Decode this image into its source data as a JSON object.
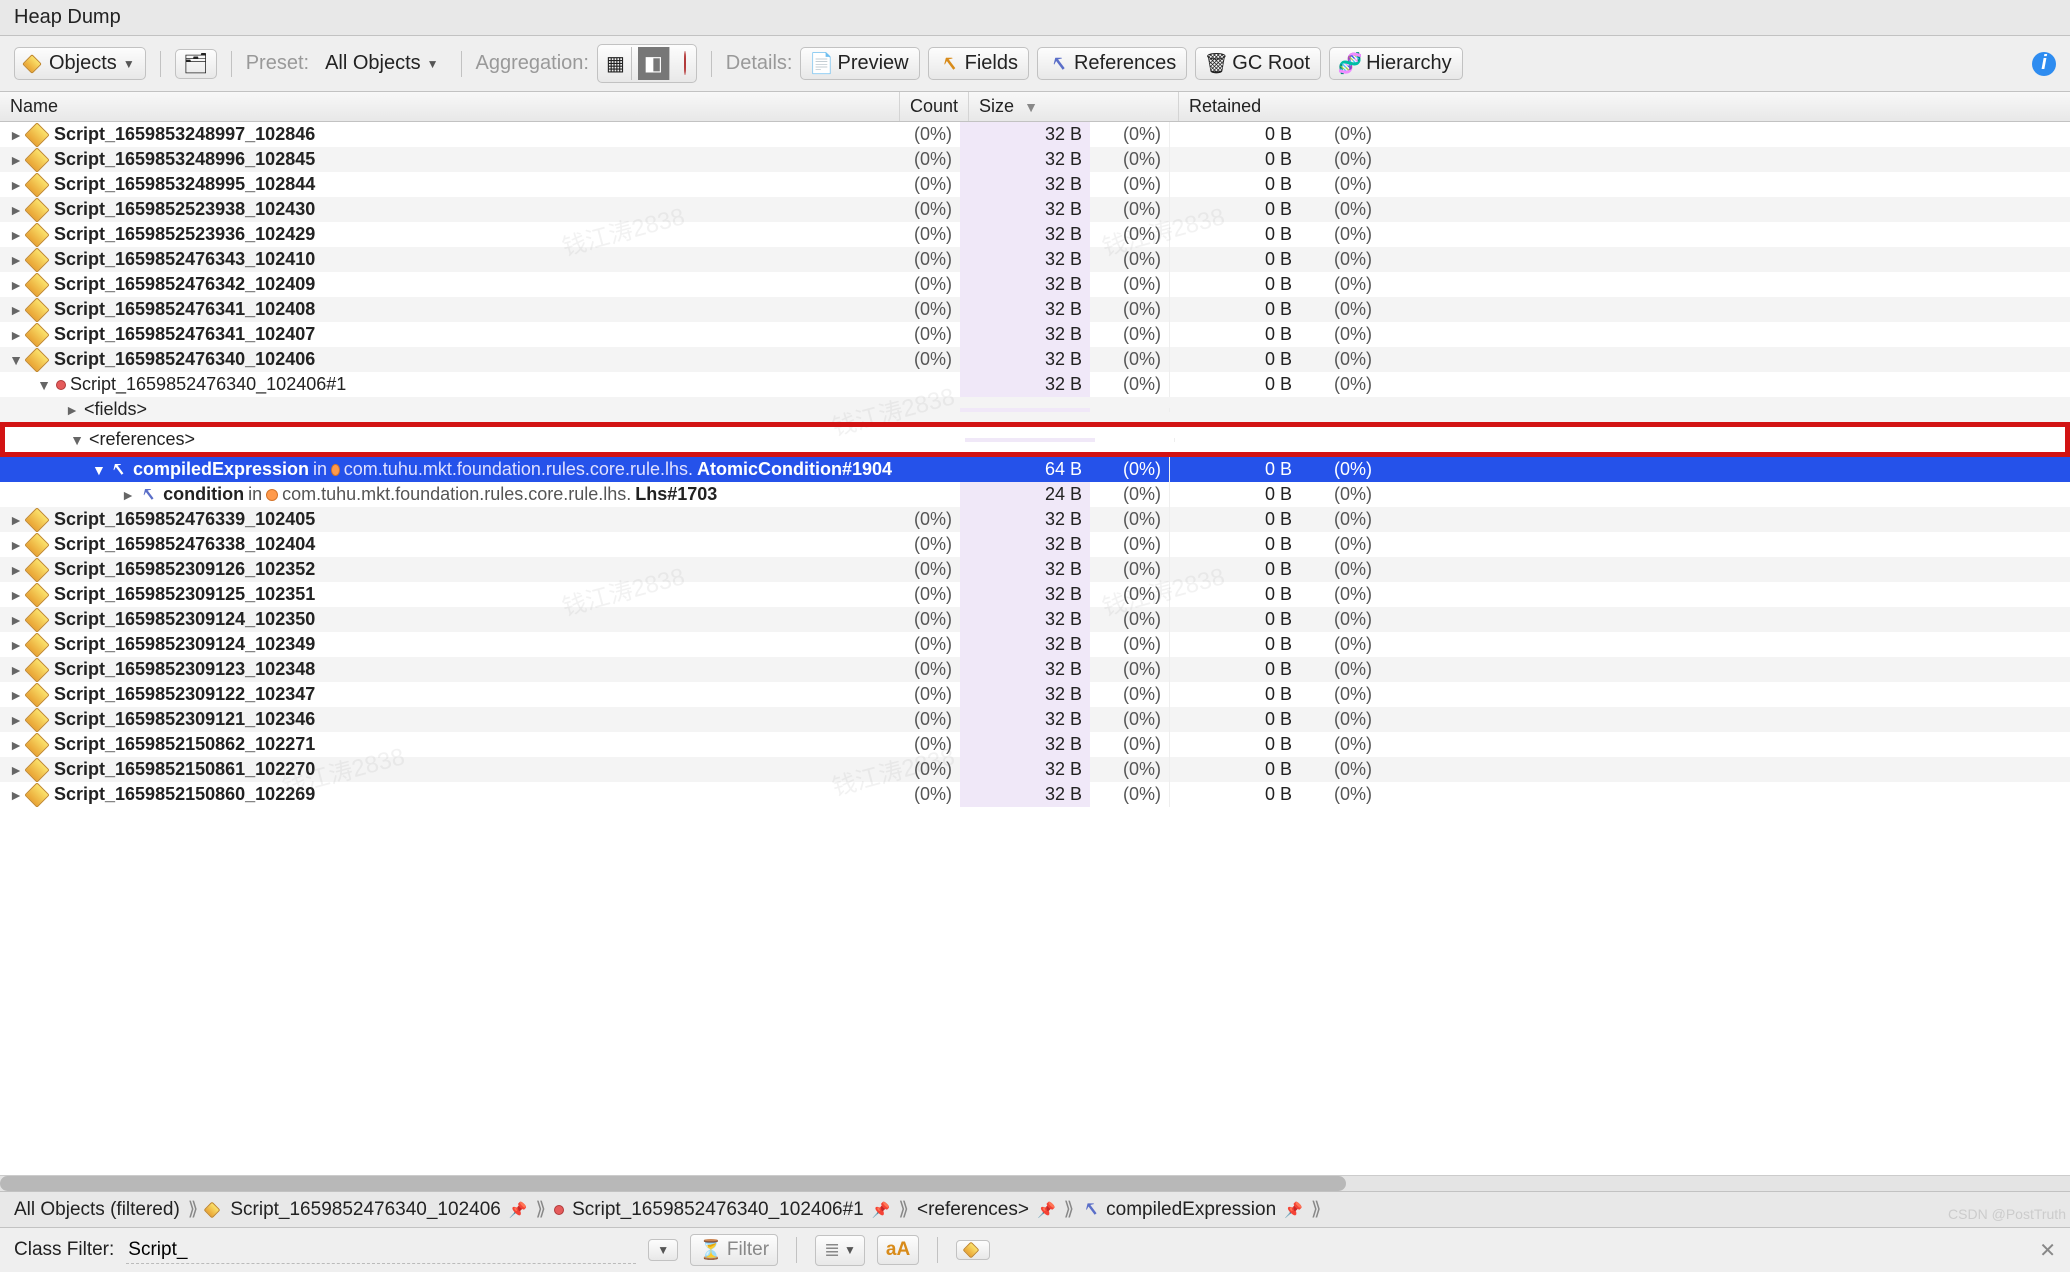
{
  "window_title": "Heap Dump",
  "toolbar": {
    "objects_btn": "Objects",
    "preset_label": "Preset:",
    "preset_value": "All Objects",
    "aggregation_label": "Aggregation:",
    "details_label": "Details:",
    "preview_btn": "Preview",
    "fields_btn": "Fields",
    "references_btn": "References",
    "gcroot_btn": "GC Root",
    "hierarchy_btn": "Hierarchy"
  },
  "columns": {
    "c0": "Name",
    "c1": "Count",
    "c2": "Size",
    "c3": "Retained"
  },
  "rows": [
    {
      "indent": 0,
      "exp": "►",
      "icon": "class",
      "name": "Script_1659853248997_102846",
      "bold": true,
      "count": "(0%)",
      "size": "32 B",
      "sizePct": "(0%)",
      "ret": "0 B",
      "retPct": "(0%)",
      "alt": false
    },
    {
      "indent": 0,
      "exp": "►",
      "icon": "class",
      "name": "Script_1659853248996_102845",
      "bold": true,
      "count": "(0%)",
      "size": "32 B",
      "sizePct": "(0%)",
      "ret": "0 B",
      "retPct": "(0%)",
      "alt": true
    },
    {
      "indent": 0,
      "exp": "►",
      "icon": "class",
      "name": "Script_1659853248995_102844",
      "bold": true,
      "count": "(0%)",
      "size": "32 B",
      "sizePct": "(0%)",
      "ret": "0 B",
      "retPct": "(0%)",
      "alt": false
    },
    {
      "indent": 0,
      "exp": "►",
      "icon": "class",
      "name": "Script_1659852523938_102430",
      "bold": true,
      "count": "(0%)",
      "size": "32 B",
      "sizePct": "(0%)",
      "ret": "0 B",
      "retPct": "(0%)",
      "alt": true
    },
    {
      "indent": 0,
      "exp": "►",
      "icon": "class",
      "name": "Script_1659852523936_102429",
      "bold": true,
      "count": "(0%)",
      "size": "32 B",
      "sizePct": "(0%)",
      "ret": "0 B",
      "retPct": "(0%)",
      "alt": false
    },
    {
      "indent": 0,
      "exp": "►",
      "icon": "class",
      "name": "Script_1659852476343_102410",
      "bold": true,
      "count": "(0%)",
      "size": "32 B",
      "sizePct": "(0%)",
      "ret": "0 B",
      "retPct": "(0%)",
      "alt": true
    },
    {
      "indent": 0,
      "exp": "►",
      "icon": "class",
      "name": "Script_1659852476342_102409",
      "bold": true,
      "count": "(0%)",
      "size": "32 B",
      "sizePct": "(0%)",
      "ret": "0 B",
      "retPct": "(0%)",
      "alt": false
    },
    {
      "indent": 0,
      "exp": "►",
      "icon": "class",
      "name": "Script_1659852476341_102408",
      "bold": true,
      "count": "(0%)",
      "size": "32 B",
      "sizePct": "(0%)",
      "ret": "0 B",
      "retPct": "(0%)",
      "alt": true
    },
    {
      "indent": 0,
      "exp": "►",
      "icon": "class",
      "name": "Script_1659852476341_102407",
      "bold": true,
      "count": "(0%)",
      "size": "32 B",
      "sizePct": "(0%)",
      "ret": "0 B",
      "retPct": "(0%)",
      "alt": false
    },
    {
      "indent": 0,
      "exp": "▼",
      "icon": "class",
      "name": "Script_1659852476340_102406",
      "bold": true,
      "count": "(0%)",
      "size": "32 B",
      "sizePct": "(0%)",
      "ret": "0 B",
      "retPct": "(0%)",
      "alt": true
    },
    {
      "indent": 1,
      "exp": "▼",
      "icon": "dot-red",
      "name": "Script_1659852476340_102406#1",
      "bold": false,
      "count": "",
      "size": "32 B",
      "sizePct": "(0%)",
      "ret": "0 B",
      "retPct": "(0%)",
      "alt": false
    },
    {
      "indent": 2,
      "exp": "►",
      "icon": "",
      "name": "<fields>",
      "bold": false,
      "count": "",
      "size": "",
      "sizePct": "",
      "ret": "",
      "retPct": "",
      "alt": true
    },
    {
      "indent": 2,
      "exp": "▼",
      "icon": "",
      "name": "<references>",
      "bold": false,
      "count": "",
      "size": "",
      "sizePct": "",
      "ret": "",
      "retPct": "",
      "alt": false,
      "boxtop": true
    },
    {
      "indent": 3,
      "exp": "▼",
      "icon": "ref",
      "name": "compiledExpression",
      "extra": " in ",
      "extra2": "com.tuhu.mkt.foundation.rules.core.rule.lhs.",
      "extra3": "AtomicCondition#1904",
      "bold": true,
      "count": "",
      "size": "64 B",
      "sizePct": "(0%)",
      "ret": "0 B",
      "retPct": "(0%)",
      "selected": true,
      "boxmid": true
    },
    {
      "indent": 4,
      "exp": "►",
      "icon": "ref",
      "name": "condition",
      "extra": " in ",
      "extra2": "com.tuhu.mkt.foundation.rules.core.rule.lhs.",
      "extra3": "Lhs#1703",
      "bold": true,
      "count": "",
      "size": "24 B",
      "sizePct": "(0%)",
      "ret": "0 B",
      "retPct": "(0%)",
      "alt": false,
      "boxbot": true
    },
    {
      "indent": 0,
      "exp": "►",
      "icon": "class",
      "name": "Script_1659852476339_102405",
      "bold": true,
      "count": "(0%)",
      "size": "32 B",
      "sizePct": "(0%)",
      "ret": "0 B",
      "retPct": "(0%)",
      "alt": true
    },
    {
      "indent": 0,
      "exp": "►",
      "icon": "class",
      "name": "Script_1659852476338_102404",
      "bold": true,
      "count": "(0%)",
      "size": "32 B",
      "sizePct": "(0%)",
      "ret": "0 B",
      "retPct": "(0%)",
      "alt": false
    },
    {
      "indent": 0,
      "exp": "►",
      "icon": "class",
      "name": "Script_1659852309126_102352",
      "bold": true,
      "count": "(0%)",
      "size": "32 B",
      "sizePct": "(0%)",
      "ret": "0 B",
      "retPct": "(0%)",
      "alt": true
    },
    {
      "indent": 0,
      "exp": "►",
      "icon": "class",
      "name": "Script_1659852309125_102351",
      "bold": true,
      "count": "(0%)",
      "size": "32 B",
      "sizePct": "(0%)",
      "ret": "0 B",
      "retPct": "(0%)",
      "alt": false
    },
    {
      "indent": 0,
      "exp": "►",
      "icon": "class",
      "name": "Script_1659852309124_102350",
      "bold": true,
      "count": "(0%)",
      "size": "32 B",
      "sizePct": "(0%)",
      "ret": "0 B",
      "retPct": "(0%)",
      "alt": true
    },
    {
      "indent": 0,
      "exp": "►",
      "icon": "class",
      "name": "Script_1659852309124_102349",
      "bold": true,
      "count": "(0%)",
      "size": "32 B",
      "sizePct": "(0%)",
      "ret": "0 B",
      "retPct": "(0%)",
      "alt": false
    },
    {
      "indent": 0,
      "exp": "►",
      "icon": "class",
      "name": "Script_1659852309123_102348",
      "bold": true,
      "count": "(0%)",
      "size": "32 B",
      "sizePct": "(0%)",
      "ret": "0 B",
      "retPct": "(0%)",
      "alt": true
    },
    {
      "indent": 0,
      "exp": "►",
      "icon": "class",
      "name": "Script_1659852309122_102347",
      "bold": true,
      "count": "(0%)",
      "size": "32 B",
      "sizePct": "(0%)",
      "ret": "0 B",
      "retPct": "(0%)",
      "alt": false
    },
    {
      "indent": 0,
      "exp": "►",
      "icon": "class",
      "name": "Script_1659852309121_102346",
      "bold": true,
      "count": "(0%)",
      "size": "32 B",
      "sizePct": "(0%)",
      "ret": "0 B",
      "retPct": "(0%)",
      "alt": true
    },
    {
      "indent": 0,
      "exp": "►",
      "icon": "class",
      "name": "Script_1659852150862_102271",
      "bold": true,
      "count": "(0%)",
      "size": "32 B",
      "sizePct": "(0%)",
      "ret": "0 B",
      "retPct": "(0%)",
      "alt": false
    },
    {
      "indent": 0,
      "exp": "►",
      "icon": "class",
      "name": "Script_1659852150861_102270",
      "bold": true,
      "count": "(0%)",
      "size": "32 B",
      "sizePct": "(0%)",
      "ret": "0 B",
      "retPct": "(0%)",
      "alt": true
    },
    {
      "indent": 0,
      "exp": "►",
      "icon": "class",
      "name": "Script_1659852150860_102269",
      "bold": true,
      "count": "(0%)",
      "size": "32 B",
      "sizePct": "(0%)",
      "ret": "0 B",
      "retPct": "(0%)",
      "alt": false
    }
  ],
  "breadcrumb": {
    "b0": "All Objects (filtered)",
    "b1": "Script_1659852476340_102406",
    "b2": "Script_1659852476340_102406#1",
    "b3": "<references>",
    "b4": "compiledExpression"
  },
  "filter": {
    "label": "Class Filter:",
    "value": "Script_",
    "filter_btn": "Filter"
  },
  "watermark": "钱江涛2838",
  "csdn": "CSDN @PostTruth"
}
